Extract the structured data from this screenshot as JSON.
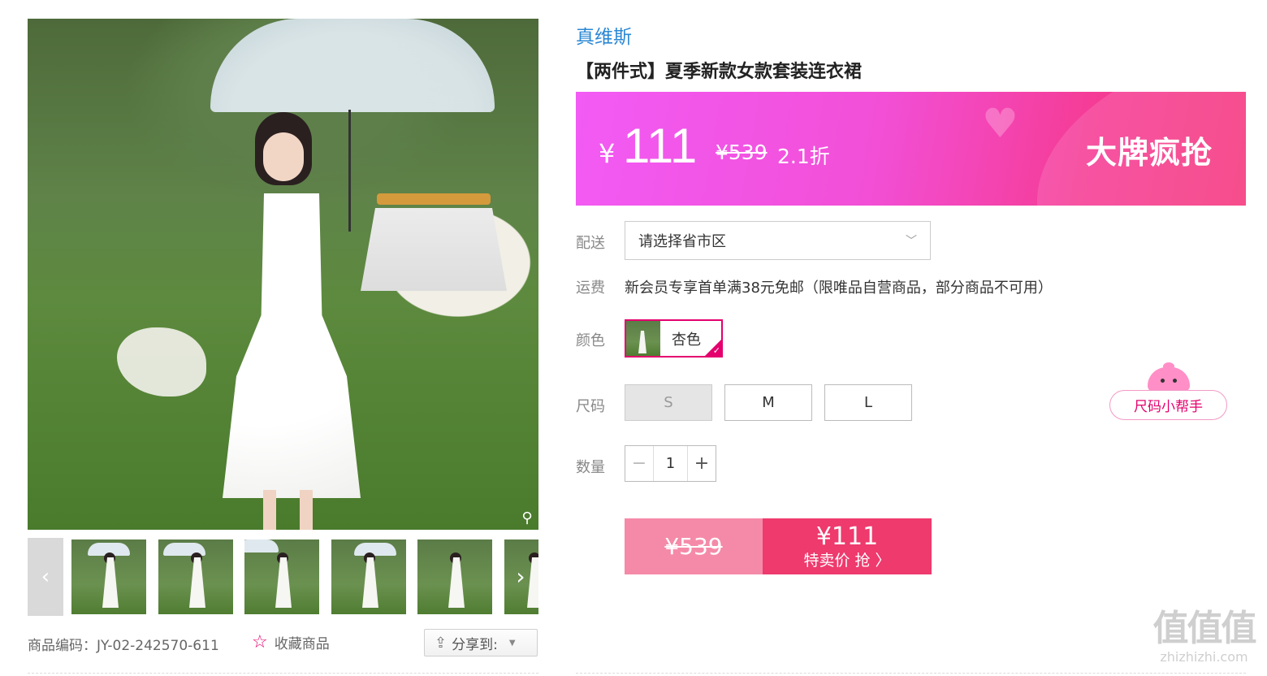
{
  "product": {
    "brand": "真维斯",
    "title": "【两件式】夏季新款女款套装连衣裙",
    "sku_label": "商品编码：JY-02-242570-611",
    "favorite_label": "收藏商品",
    "share_label": "分享到:"
  },
  "price_banner": {
    "currency": "¥",
    "price": "111",
    "original_price": "¥539",
    "discount": "2.1折",
    "promo_text": "大牌疯抢",
    "colors": {
      "start": "#f25bf5",
      "end": "#f5357c"
    }
  },
  "delivery": {
    "label": "配送",
    "select_placeholder": "请选择省市区"
  },
  "shipping": {
    "label": "运费",
    "text": "新会员专享首单满38元免邮（限唯品自营商品，部分商品不可用）"
  },
  "color": {
    "label": "颜色",
    "selected": "杏色"
  },
  "size": {
    "label": "尺码",
    "options": [
      {
        "label": "S",
        "disabled": true
      },
      {
        "label": "M",
        "disabled": false
      },
      {
        "label": "L",
        "disabled": false
      }
    ],
    "helper_label": "尺码小帮手"
  },
  "quantity": {
    "label": "数量",
    "minus": "−",
    "value": "1",
    "plus": "+"
  },
  "buy": {
    "original_price": "¥539",
    "price": "¥111",
    "sub_label": "特卖价 抢 〉",
    "colors": {
      "old": "#f58aa8",
      "main": "#ee3a6d"
    }
  },
  "thumbnails": {
    "count_visible": 6,
    "prev_icon": "‹",
    "next_icon": "›"
  },
  "watermark": {
    "main": "值值值",
    "sub": "zhizhizhi.com"
  },
  "accent_color": "#e4006d"
}
